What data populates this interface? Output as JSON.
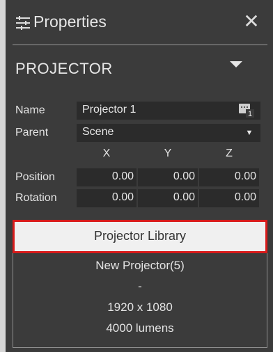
{
  "header": {
    "title": "Properties",
    "close_glyph": "✕"
  },
  "section": {
    "label": "PROJECTOR"
  },
  "name": {
    "label": "Name",
    "value": "Projector 1",
    "badge_count": "1"
  },
  "parent": {
    "label": "Parent",
    "value": "Scene"
  },
  "axes": [
    "X",
    "Y",
    "Z"
  ],
  "position": {
    "label": "Position",
    "values": [
      "0.00",
      "0.00",
      "0.00"
    ]
  },
  "rotation": {
    "label": "Rotation",
    "values": [
      "0.00",
      "0.00",
      "0.00"
    ]
  },
  "library": {
    "button_label": "Projector Library",
    "model": "New Projector(5)",
    "separator": "-",
    "resolution": "1920 x 1080",
    "brightness": "4000 lumens"
  },
  "icons": {
    "title": "sliders-icon",
    "close": "close-icon",
    "section": "caret-down-icon",
    "parent": "dropdown-arrow-icon"
  },
  "colors": {
    "panel": "#3b3b3b",
    "field": "#2b2b2b",
    "highlight": "#d81b1b"
  }
}
